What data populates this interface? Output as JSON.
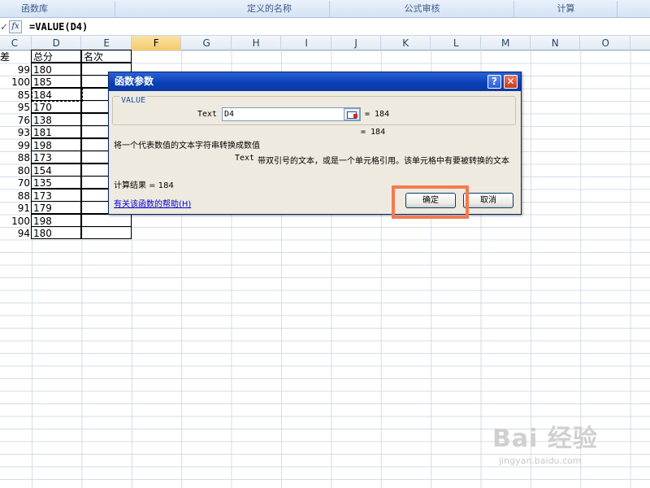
{
  "ribbon": {
    "groups": [
      "函数库",
      "定义的名称",
      "公式审核",
      "计算"
    ]
  },
  "formula_bar": {
    "cancel_icon": "✓",
    "fx_label": "fx",
    "formula": "=VALUE(D4)"
  },
  "columns": [
    "C",
    "D",
    "E",
    "F",
    "G",
    "H",
    "I",
    "J",
    "K",
    "L",
    "M",
    "N",
    "O"
  ],
  "active_column": "F",
  "sheet": {
    "header_c": "差",
    "header_d": "总分",
    "header_e": "名次",
    "c_values": [
      "99",
      "100",
      "85",
      "95",
      "76",
      "93",
      "99",
      "88",
      "80",
      "70",
      "88",
      "91",
      "100",
      "94"
    ],
    "d_values": [
      "180",
      "185",
      "184",
      "170",
      "138",
      "181",
      "198",
      "173",
      "154",
      "135",
      "173",
      "179",
      "198",
      "180"
    ]
  },
  "dialog": {
    "title": "函数参数",
    "help_icon": "?",
    "close_icon": "✕",
    "function_name": "VALUE",
    "arg_label": "Text",
    "arg_value": "D4",
    "arg_result": "= 184",
    "formula_result": "= 184",
    "description": "将一个代表数值的文本字符串转换成数值",
    "arg_desc_name": "Text",
    "arg_desc_text": "带双引号的文本，或是一个单元格引用。该单元格中有要被转换的文本",
    "calc_result": "计算结果 = 184",
    "help_link": "有关该函数的帮助(H)",
    "ok_label": "确定",
    "cancel_label": "取消"
  },
  "watermark": {
    "logo": "Bai 经验",
    "url": "jingyan.baidu.com"
  },
  "colors": {
    "title_bar": "#0a3fb4",
    "highlight_box": "#f47b4f",
    "link": "#0000cc"
  }
}
